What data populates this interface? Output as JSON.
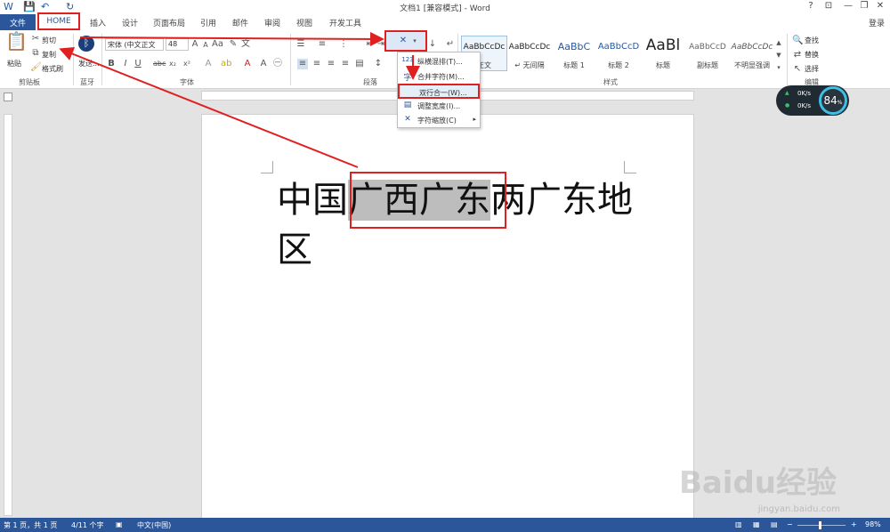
{
  "window": {
    "title": "文档1 [兼容模式] - Word",
    "help": "?",
    "restore_ribbon": "⊡",
    "minimize": "—",
    "maximize": "❐",
    "close": "✕",
    "login": "登录"
  },
  "tabs": {
    "file": "文件",
    "home": "HOME",
    "insert": "插入",
    "design": "设计",
    "layout": "页面布局",
    "references": "引用",
    "mailings": "邮件",
    "review": "审阅",
    "view": "视图",
    "developer": "开发工具"
  },
  "ribbon": {
    "clipboard": {
      "label": "剪贴板",
      "paste": "粘贴",
      "cut": "剪切",
      "copy": "复制",
      "format_painter": "格式刷"
    },
    "bluetooth": {
      "label": "蓝牙",
      "send": "发送..."
    },
    "font": {
      "label": "字体",
      "font_name": "宋体 (中文正文",
      "font_size": "48"
    },
    "paragraph": {
      "label": "段落"
    },
    "styles": {
      "label": "样式",
      "items": [
        {
          "preview": "AaBbCcDc",
          "name": "正文"
        },
        {
          "preview": "AaBbCcDc",
          "name": "↵ 无间隔"
        },
        {
          "preview": "AaBbC",
          "name": "标题 1"
        },
        {
          "preview": "AaBbCcD",
          "name": "标题 2"
        },
        {
          "preview": "AaBl",
          "name": "标题"
        },
        {
          "preview": "AaBbCcD",
          "name": "副标题"
        },
        {
          "preview": "AaBbCcDc",
          "name": "不明显强调"
        }
      ]
    },
    "editing": {
      "label": "编辑",
      "find": "查找",
      "replace": "替换",
      "select": "选择"
    }
  },
  "asian_layout_menu": [
    {
      "icon": "123",
      "label": "纵横混排(T)..."
    },
    {
      "icon": "字",
      "label": "合并字符(M)..."
    },
    {
      "icon": "",
      "label": "双行合一(W)..."
    },
    {
      "icon": "▤",
      "label": "调整宽度(I)..."
    },
    {
      "icon": "✕",
      "label": "字符缩放(C)"
    }
  ],
  "document": {
    "before": "中国",
    "selected": "广西广东",
    "after": "两广东地区"
  },
  "speed_widget": {
    "up": "0K/s",
    "down": "0K/s",
    "percent": "84",
    "unit": "%"
  },
  "statusbar": {
    "page": "第 1 页，共 1 页",
    "words": "4/11 个字",
    "language": "中文(中国)",
    "zoom": "98%"
  },
  "watermark": {
    "brand": "Baidu经验",
    "url": "jingyan.baidu.com"
  },
  "colors": {
    "accent": "#2b579a",
    "annotation": "#e02020",
    "selection": "#bdbdbd"
  }
}
